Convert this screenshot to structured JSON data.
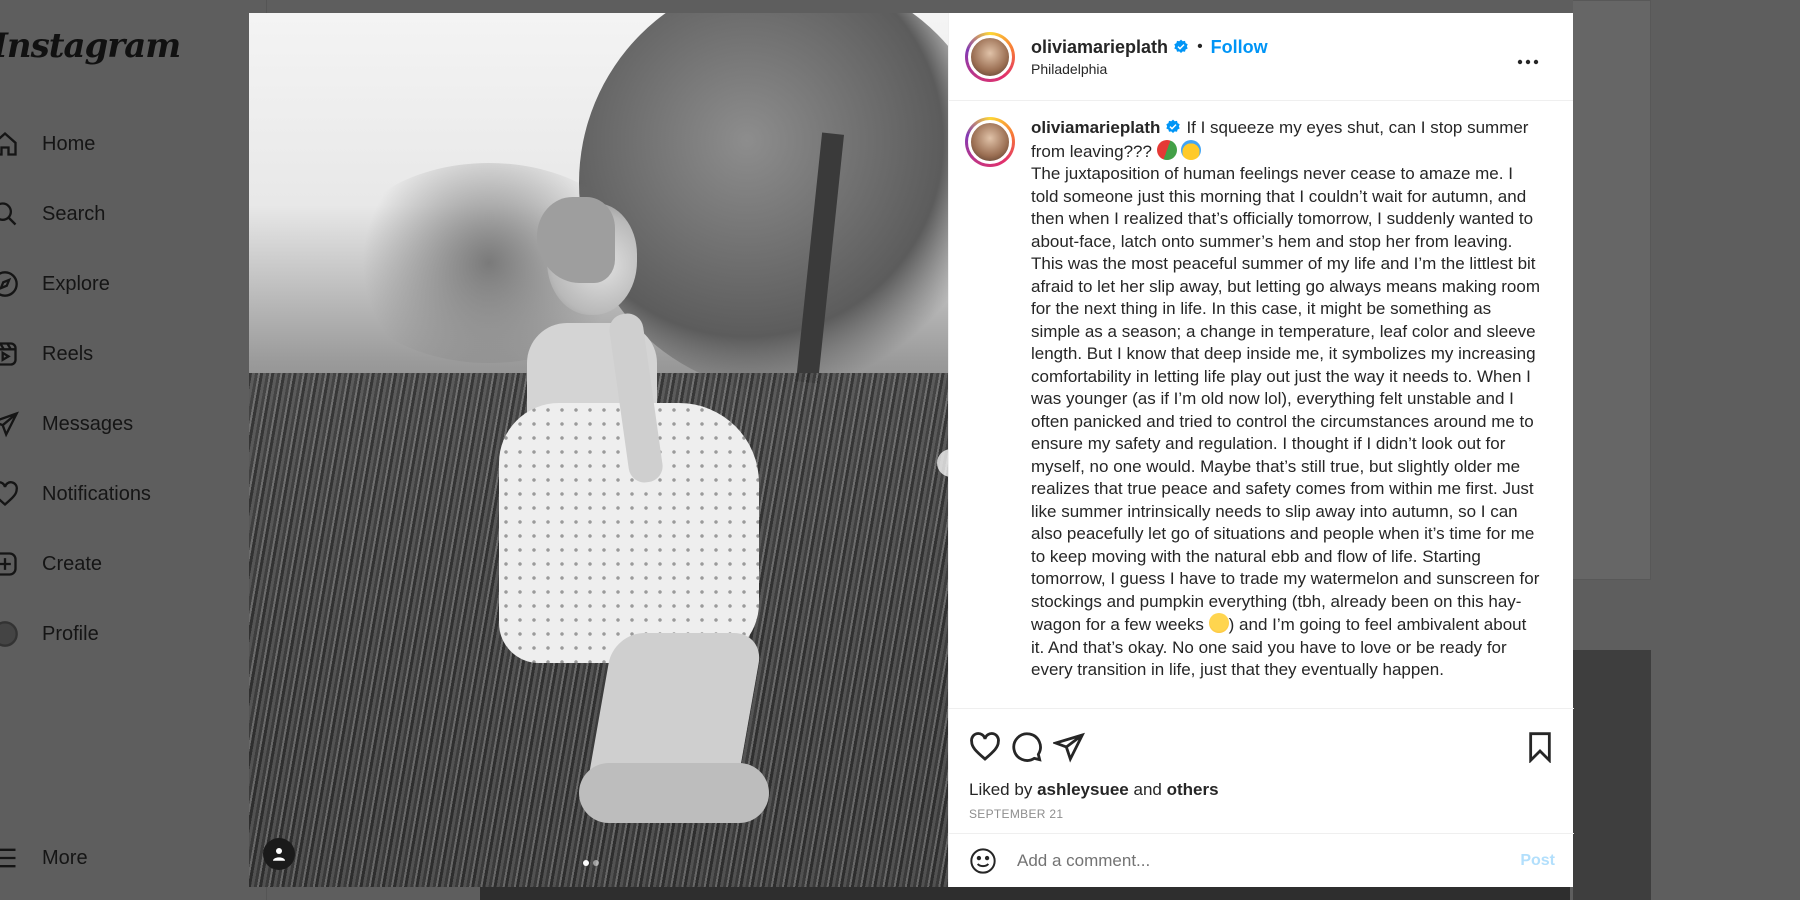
{
  "app": {
    "logo": "Instagram"
  },
  "sidebar": {
    "items": [
      {
        "label": "Home",
        "icon": "home-icon"
      },
      {
        "label": "Search",
        "icon": "search-icon"
      },
      {
        "label": "Explore",
        "icon": "compass-icon"
      },
      {
        "label": "Reels",
        "icon": "reels-icon"
      },
      {
        "label": "Messages",
        "icon": "paper-plane-icon"
      },
      {
        "label": "Notifications",
        "icon": "heart-icon"
      },
      {
        "label": "Create",
        "icon": "plus-square-icon"
      },
      {
        "label": "Profile",
        "icon": "profile-avatar-icon"
      }
    ],
    "more_label": "More"
  },
  "post": {
    "username": "oliviamarieplath",
    "verified": true,
    "separator": "•",
    "follow_label": "Follow",
    "location": "Philadelphia",
    "more_options_icon": "more-horizontal-icon",
    "caption": {
      "username": "oliviamarieplath",
      "first_line": "If I squeeze my eyes shut, can I stop summer from leaving???",
      "body_part1": "The juxtaposition of human feelings never cease to amaze me. I told someone just this morning that I couldn’t wait for autumn, and then when I realized that’s officially tomorrow, I suddenly wanted to about-face, latch onto summer’s hem and stop her from leaving. This was the most peaceful summer of my life and I’m the littlest bit afraid to let her slip away, but letting go always means making room for the next thing in life. In this case, it might be something as simple as a season; a change in temperature, leaf color and sleeve length. But I know that deep inside me, it symbolizes my increasing comfortability in letting life play out just the way it needs to. When I was younger (as if I’m old now lol), everything felt unstable and I often panicked and tried to control the circumstances around me to ensure my safety and regulation. I thought if I didn’t look out for myself, no one would. Maybe that’s still true, but slightly older me realizes that true peace and safety comes from within me first. Just like summer intrinsically needs to slip away into autumn, so I can also peacefully let go of situations and people when it’s time for me to keep moving with the natural ebb and flow of life. Starting tomorrow, I guess I have to trade my watermelon and sunscreen for stockings and pumpkin everything (tbh, already been on this hay-wagon for a few weeks",
      "body_part2": ") and I’m going to feel ambivalent about it. And that’s okay. No one said you have to love or be ready for every transition in life, just that they eventually happen."
    },
    "liked_by_prefix": "Liked by",
    "liked_by_user": "ashleysuee",
    "liked_by_and": "and",
    "liked_by_others": "others",
    "date": "SEPTEMBER 21",
    "comment_placeholder": "Add a comment...",
    "post_label": "Post",
    "next_label": "›",
    "carousel": {
      "count": 2,
      "active_index": 0
    }
  },
  "colors": {
    "accent": "#0095f6",
    "post_disabled": "#b2dffc",
    "verified": "#0095f6"
  }
}
